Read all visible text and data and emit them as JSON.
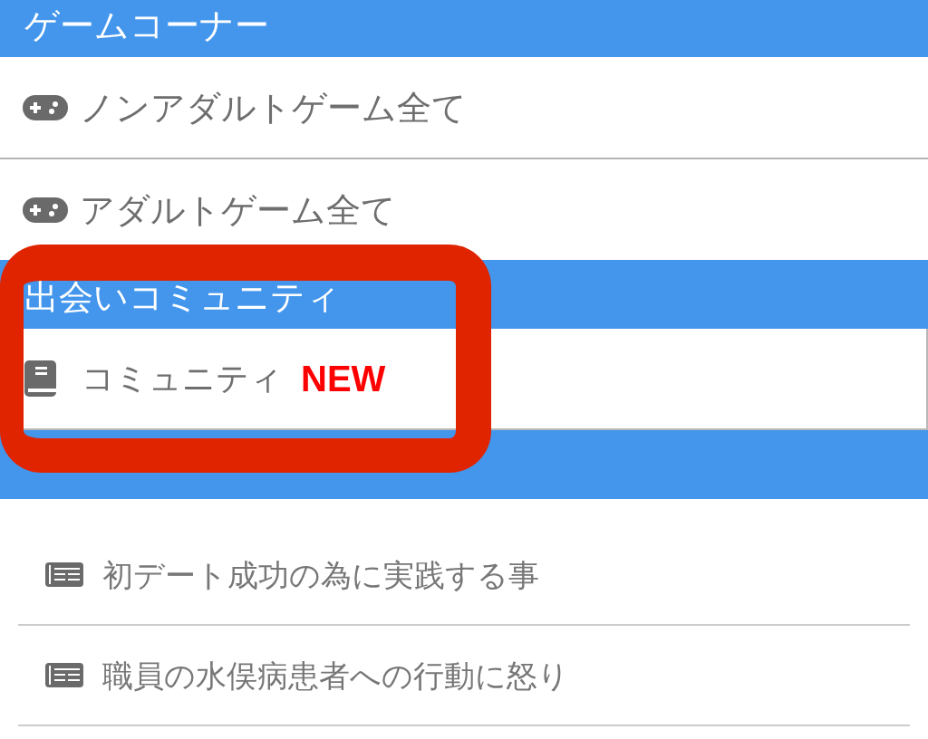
{
  "menu": [
    {
      "kind": "header",
      "title": "ゲームコーナー"
    },
    {
      "kind": "game",
      "label": "ノンアダルトゲーム全て"
    },
    {
      "kind": "game",
      "label": "アダルトゲーム全て"
    },
    {
      "kind": "header",
      "title": "出会いコミュニティ"
    },
    {
      "kind": "community",
      "label": "コミュニティ",
      "badge": "NEW"
    },
    {
      "kind": "header"
    },
    {
      "kind": "news",
      "label": "初デート成功の為に実践する事"
    },
    {
      "kind": "news",
      "label": "職員の水俣病患者への行動に怒り"
    }
  ]
}
